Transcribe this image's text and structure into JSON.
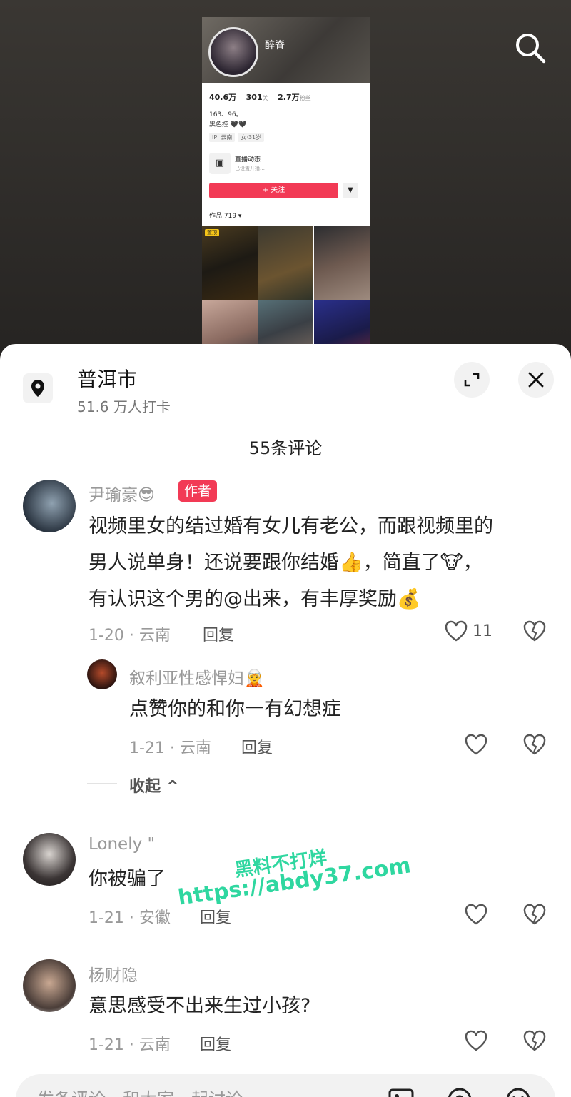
{
  "profile": {
    "name": "醉脊",
    "sub": "",
    "stats": [
      {
        "value": "40.6万",
        "label": ""
      },
      {
        "value": "301",
        "label": "关"
      },
      {
        "value": "2.7万",
        "label": "粉丝"
      }
    ],
    "bio_line1": "163、96。",
    "bio_line2": "黑色控 🖤🖤",
    "tags": [
      "IP: 云南",
      "女·31岁"
    ],
    "live_title": "直播动态",
    "live_sub": "已设置开播…",
    "follow_label": "+ 关注",
    "follow_more": "▼",
    "works_label": "作品 719 ▾",
    "pin_badge": "置顶"
  },
  "location": {
    "title": "普洱市",
    "checkins": "51.6 万人打卡"
  },
  "comments_count": "55条评论",
  "comments": [
    {
      "user": "尹瑜豪😎",
      "badge": "作者",
      "line1": "视频里女的结过婚有女儿有老公，而跟视频里的",
      "line2": "男人说单身！还说要跟你结婚👍，简直了🐮，",
      "line3": "有认识这个男的@出来，有丰厚奖励💰",
      "meta": "1-20 · 云南",
      "reply": "回复",
      "likes": "11"
    },
    {
      "user": "叙利亚性感悍妇🧝",
      "text": "点赞你的和你一有幻想症",
      "meta": "1-21 · 云南",
      "reply": "回复"
    },
    {
      "user": "Lonely \"",
      "text": "你被骗了",
      "meta": "1-21 · 安徽",
      "reply": "回复"
    },
    {
      "user": "杨财隐",
      "text": "意思感受不出来生过小孩?",
      "meta": "1-21 · 云南",
      "reply": "回复"
    }
  ],
  "collapse_label": "收起 ^",
  "watermark": {
    "line1": "黑料不打烊",
    "line2": "https://abdy37.com"
  },
  "input_placeholder": "发条评论，和大家一起讨论",
  "icons": [
    "search-icon",
    "location-pin-icon",
    "expand-icon",
    "close-icon",
    "heart-icon",
    "broken-heart-icon",
    "image-icon",
    "at-icon",
    "emoji-icon"
  ]
}
